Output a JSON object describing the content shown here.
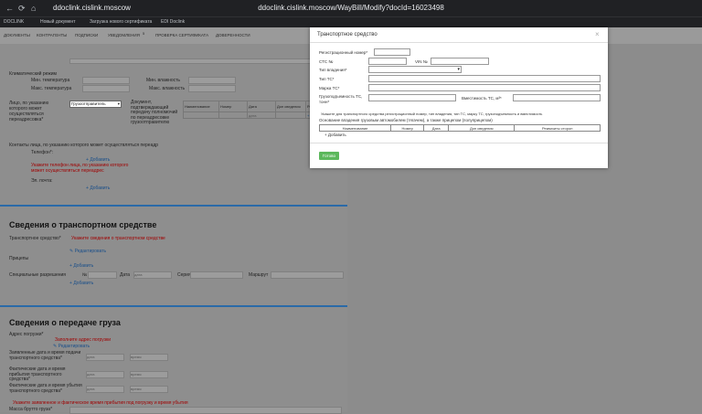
{
  "browser": {
    "back_icon": "arrow-left-icon",
    "forward_icon": "arrow-right-icon",
    "reload_icon": "reload-icon",
    "site": "ddoclink.cislink.moscow",
    "url": "ddoclink.cislink.moscow/WayBill/Modify?docId=16023498"
  },
  "bookmarks": [
    "DOCLINK",
    "Новый документ",
    "Загрузка нового сертификата",
    "EDI Doclink"
  ],
  "top_nav": [
    "ДОКУМЕНТЫ",
    "КОНТРАГЕНТЫ",
    "ПОДПИСКИ",
    "УВЕДОМЛЕНИЯ",
    "5",
    "ПРОВЕРКА СЕРТИФИКАТА",
    "ДОВЕРЕННОСТИ"
  ],
  "climate": {
    "title": "Климатический режим",
    "min_temp": "Мин. температура",
    "max_temp": "Макс. температура",
    "min_humidity": "Мин. влажность",
    "max_humidity": "Макс. влажность"
  },
  "person": {
    "label": "Лицо, по указанию которого может осуществляться переадресовка*",
    "select_value": "Грузоотправитель",
    "doc_label": "Документ, подтверждающий передачу полномочий по переадресовке грузоотправителю",
    "table_headers": [
      "Наименование",
      "Номер",
      "Дата",
      "Доп сведения",
      "Ре"
    ],
    "date_placeholder": "дата"
  },
  "contacts": {
    "label": "Контакты лица, по указанию которого может осуществляться переадр",
    "phone": "Телефон*:",
    "add": "Добавить",
    "error": "Укажите телефон лица, по указанию которого может осуществляться переадрес",
    "email": "Эл. почта:",
    "add2": "Добавить"
  },
  "vehicle_section": {
    "title": "Сведения о транспортном средстве",
    "vehicle_label": "Транспортное средство*",
    "vehicle_error": "Укажите сведения о транспортном средстве",
    "edit": "Редактировать",
    "trailers": "Прицепы",
    "add": "Добавить",
    "special": "Специальные разрешения",
    "no": "№",
    "date": "Дата",
    "date_ph": "дата",
    "series": "Серия",
    "route": "Маршрут",
    "add2": "Добавить"
  },
  "cargo_section": {
    "title": "Сведения о передаче груза",
    "address": "Адрес погрузки*",
    "address_error": "Заполните адрес погрузки",
    "edit": "Редактировать",
    "planned": "Заявленные дата и время подачи транспортного средства*",
    "actual_arrival": "Фактические дата и время прибытия транспортного средства*",
    "actual_departure": "Фактические дата и время убытия транспортного средства*",
    "date_ph": "дата",
    "time_ph": "время",
    "error": "Укажите заявленное и фактическое время прибытия под погрузку и время убытия",
    "mass": "Масса брутто груза*"
  },
  "modal": {
    "title": "Транспортное средство",
    "close": "×",
    "reg_number": "Регистрационный номер*",
    "sts": "СТС №",
    "vin": "VIN №",
    "ownership": "Тип владения*",
    "type": "Тип ТС*",
    "brand": "Марка ТС*",
    "capacity": "Грузоподъемность ТС, тонн*",
    "volume": "Вместимость ТС, м³*",
    "error": "Укажите для транспортного средства регистрационный номер, тип владения, тип ТС, марку ТС, грузоподъемность и вместимость",
    "basis": "Основание владения грузовым автомобилем (тягачем), а также прицепом (полуприцепом)",
    "table_headers": [
      "Наименование",
      "Номер",
      "Дата",
      "Доп сведения",
      "Реквизиты сторон"
    ],
    "add": "Добавить",
    "save": "Готово"
  }
}
